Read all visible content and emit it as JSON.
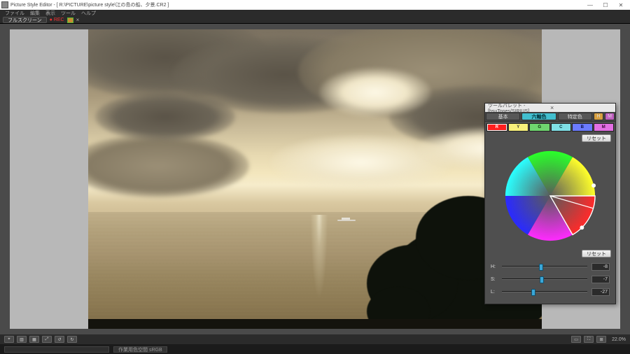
{
  "window": {
    "title": "Picture Style Editor - [ R:\\PICTURE\\picture style\\江の島の船、夕景.CR2 ]",
    "min": "—",
    "max": "☐",
    "close": "✕"
  },
  "menubar": {
    "items": [
      "ファイル",
      "編集",
      "表示",
      "ツール",
      "ヘルプ"
    ]
  },
  "tabstrip": {
    "fullscreen": "フルスクリーン",
    "rec": "● REC",
    "x": "×"
  },
  "bottom": {
    "tools": [
      "⌖",
      "▥",
      "▦",
      "⤢",
      "↺",
      "↻"
    ],
    "right_tools": [
      "▭",
      "⛶",
      "⊞"
    ],
    "zoom": "22.0%"
  },
  "status": {
    "msg": "作業用色空間  sRGB"
  },
  "palette": {
    "title": "ツールパレット - [hsuTones/SIRIUS]",
    "close": "×",
    "tabs": {
      "basic": "基本",
      "six": "六軸色",
      "specific": "特定色"
    },
    "mini_h": "H",
    "mini_m": "M",
    "swatches": [
      {
        "label": "R",
        "bg": "#ff1e1e",
        "fg": "#ffffff"
      },
      {
        "label": "Y",
        "bg": "#f8f07a",
        "fg": "#333333"
      },
      {
        "label": "G",
        "bg": "#6fd66f",
        "fg": "#083008"
      },
      {
        "label": "C",
        "bg": "#7fe0e7",
        "fg": "#043238"
      },
      {
        "label": "B",
        "bg": "#6b7bff",
        "fg": "#0a1050"
      },
      {
        "label": "M",
        "bg": "#e46fe4",
        "fg": "#3a0838"
      }
    ],
    "reset": "リセット",
    "sliders": {
      "H": {
        "label": "H:",
        "value": "-8",
        "pos": 46
      },
      "S": {
        "label": "S:",
        "value": "-7",
        "pos": 46.5
      },
      "L": {
        "label": "L:",
        "value": "-27",
        "pos": 37
      }
    }
  }
}
